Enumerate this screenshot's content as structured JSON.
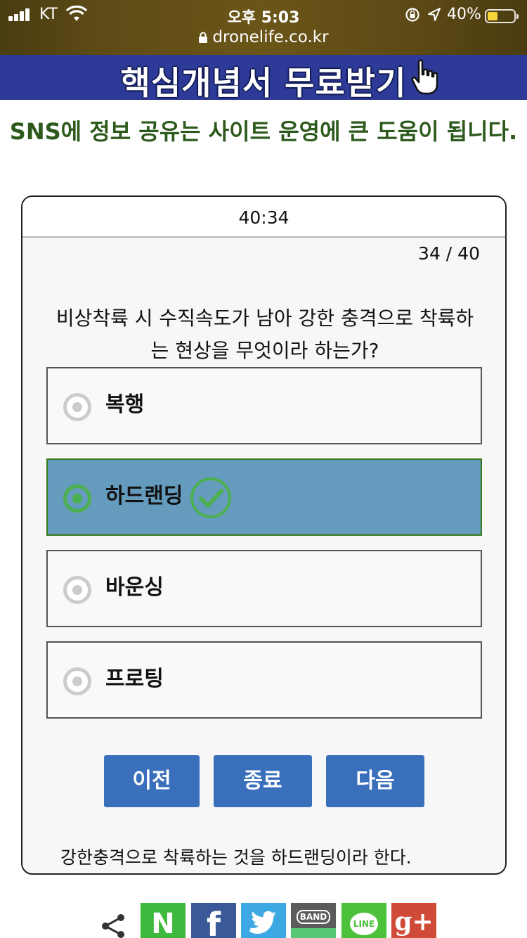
{
  "status_bar": {
    "carrier": "KT",
    "time": "오후 5:03",
    "battery_percent": "40%",
    "battery_level": 0.4
  },
  "browser": {
    "url": "dronelife.co.kr"
  },
  "banner": {
    "text": "핵심개념서 무료받기"
  },
  "sns_note": "SNS에 정보 공유는 사이트 운영에 큰 도움이 됩니다.",
  "quiz": {
    "timer": "40:34",
    "counter": "34 / 40",
    "question": "비상착륙 시 수직속도가 남아 강한 충격으로 착륙하는 현상을 무엇이라 하는가?",
    "options": [
      {
        "label": "복행",
        "selected": false
      },
      {
        "label": "하드랜딩",
        "selected": true,
        "correct": true
      },
      {
        "label": "바운싱",
        "selected": false
      },
      {
        "label": "프로팅",
        "selected": false
      }
    ],
    "buttons": {
      "prev": "이전",
      "end": "종료",
      "next": "다음"
    },
    "explanation": "강한충격으로 착륙하는 것을 하드랜딩이라 한다."
  },
  "share": {
    "items": [
      {
        "name": "naver",
        "label": "N",
        "color": "#3dba3d"
      },
      {
        "name": "facebook",
        "label": "f",
        "color": "#3b5998"
      },
      {
        "name": "twitter",
        "color": "#3da9e4"
      },
      {
        "name": "band",
        "label": "BAND",
        "color": "#5b5b5b"
      },
      {
        "name": "line",
        "label": "LINE",
        "color": "#4bc23a"
      },
      {
        "name": "google-plus",
        "label": "g+",
        "color": "#cf4a37"
      }
    ]
  },
  "colors": {
    "banner_bg": "#2d3a97",
    "selected_option_bg": "#659bbd",
    "button_bg": "#3a70bb",
    "note_text": "#2d5a1c"
  }
}
